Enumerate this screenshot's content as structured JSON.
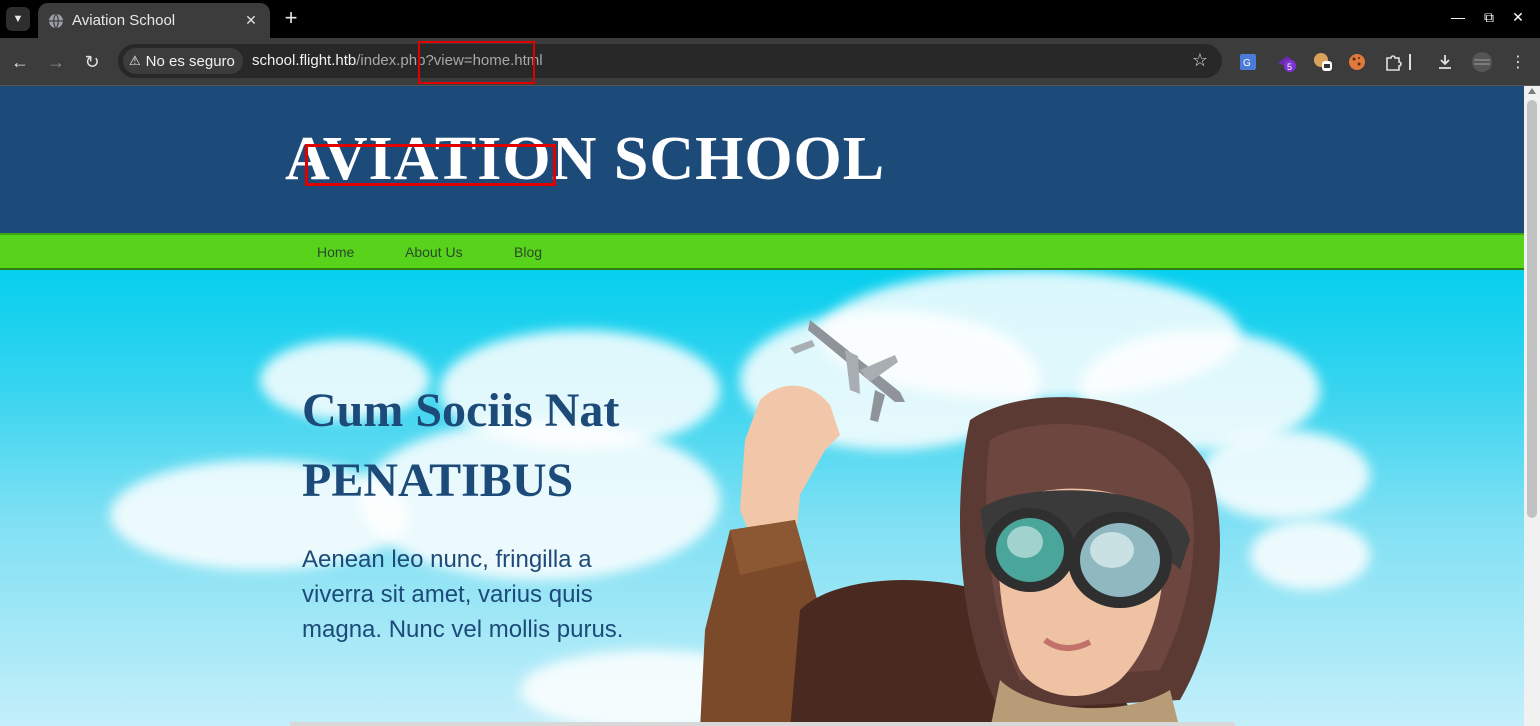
{
  "browser": {
    "tab_title": "Aviation School",
    "security_label": "No es seguro",
    "url_host": "school.flight.htb",
    "url_rest": "/index.php?view=home.html",
    "extension_badge": "5"
  },
  "site": {
    "title": "AVIATION SCHOOL",
    "menu": [
      {
        "label": "Home"
      },
      {
        "label": "About Us"
      },
      {
        "label": "Blog"
      }
    ]
  },
  "hero": {
    "heading_line1": "Cum Sociis Nat",
    "heading_line2": "PENATIBUS",
    "text": "Aenean leo nunc, fringilla a viverra sit amet, varius quis magna. Nunc vel mollis purus."
  },
  "colors": {
    "header_bg": "#1c4a79",
    "menu_bg": "#57d31b",
    "annotation": "#e00000"
  },
  "icons": [
    "tab-menu-icon",
    "globe-icon",
    "close-icon",
    "plus-icon",
    "back-icon",
    "forward-icon",
    "reload-icon",
    "warning-icon",
    "star-icon",
    "download-icon",
    "more-icon"
  ]
}
